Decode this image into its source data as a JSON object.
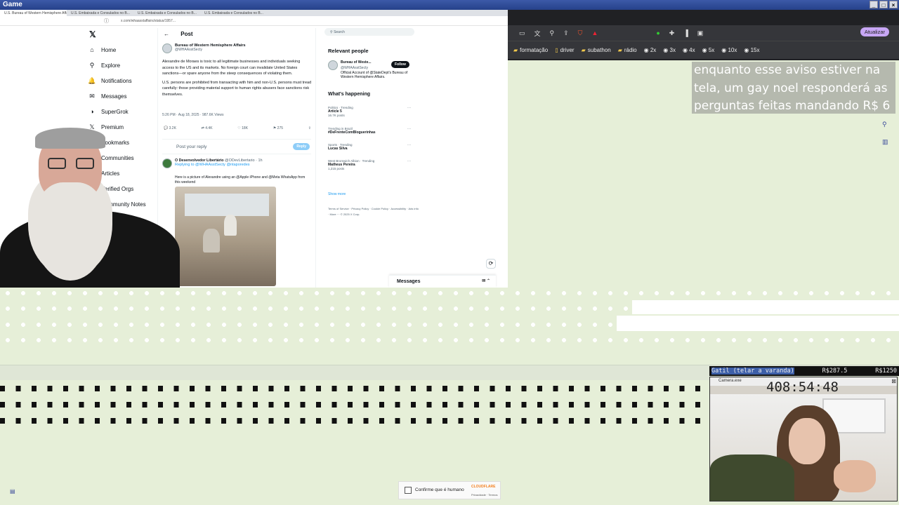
{
  "window": {
    "title": "Game"
  },
  "browser": {
    "tabs": [
      "U.S. Bureau of Western Hemisphere Affairs",
      "U.S. Embaixada e Consulados no B...",
      "U.S. Embaixada e Consulados no B...",
      "U.S. Embaixada e Consulados no B..."
    ],
    "url": "x.com/whaasstaffairs/status/1957..."
  },
  "x_nav": {
    "items": [
      {
        "icon": "home-icon",
        "glyph": "⌂",
        "label": "Home"
      },
      {
        "icon": "search-icon",
        "glyph": "⚲",
        "label": "Explore"
      },
      {
        "icon": "bell-icon",
        "glyph": "🔔",
        "label": "Notifications"
      },
      {
        "icon": "mail-icon",
        "glyph": "✉",
        "label": "Messages"
      },
      {
        "icon": "grok-icon",
        "glyph": "◑",
        "label": "SuperGrok"
      },
      {
        "icon": "x-icon",
        "glyph": "𝕏",
        "label": "Premium"
      },
      {
        "icon": "bookmark-icon",
        "glyph": "🔖",
        "label": "Bookmarks"
      },
      {
        "icon": "communities-icon",
        "glyph": "👥",
        "label": "Communities"
      },
      {
        "icon": "articles-icon",
        "glyph": "▤",
        "label": "Articles"
      },
      {
        "icon": "orgs-icon",
        "glyph": "⚡",
        "label": "Verified Orgs"
      },
      {
        "icon": "notes-icon",
        "glyph": "✎",
        "label": "Community Notes"
      }
    ]
  },
  "post": {
    "header": "Post",
    "author_name": "Bureau of Western Hemisphere Affairs",
    "author_handle": "@WHAAsstSecty",
    "p1": "Alexandre de Moraes is toxic to all legitimate businesses and individuals seeking access to the US and its markets. No foreign court can invalidate United States sanctions—or spare anyone from the steep consequences of violating them.",
    "p2": "U.S. persons are prohibited from transacting with him and non-U.S. persons must tread carefully: those providing material support to human rights abusers face sanctions risk themselves.",
    "meta": "5:26 PM · Aug 18, 2025 · 987.6K Views",
    "replies": "3.2K",
    "reposts": "4.4K",
    "likes": "18K",
    "bookmarks": "275",
    "reply_placeholder": "Post your reply",
    "reply_button": "Reply"
  },
  "reply": {
    "author": "O Desenvolvedor Libertário",
    "handle": "@ODevLibertario · 1h",
    "replying_to": "Replying to @WHAAsstSecty @ntaporedes",
    "text": "Here is a picture of Alexandre using an @Apple iPhone and @Meta WhatsApp from this weekend"
  },
  "right_sidebar": {
    "search_placeholder": "Search",
    "relevant_title": "Relevant people",
    "person_name": "Bureau of Weste...",
    "person_handle": "@WHAAsstSecty",
    "person_bio": "Official Account of @StateDept's Bureau of Western Hemisphere Affairs.",
    "follow_label": "Follow",
    "happening_title": "What's happening",
    "trends": [
      {
        "category": "Politics · Trending",
        "title": "Artícle 5",
        "count": "16.7K posts"
      },
      {
        "category": "Trending in Brazil",
        "title": "#DeFrenteComBloguerinhas",
        "count": ""
      },
      {
        "category": "Sports · Trending",
        "title": "Lucas Silva",
        "count": ""
      },
      {
        "category": "West Bromwich Albion · Trending",
        "title": "Matheus Pereira",
        "count": "1,215 posts"
      }
    ],
    "show_more": "Show more",
    "footer": "Terms of Service · Privacy Policy · Cookie Policy · Accessibility · Ads info · More ··· © 2025 X Corp.",
    "messages_label": "Messages"
  },
  "right_browser": {
    "update_label": "Atualizar",
    "bookmarks": [
      "formatação",
      "driver",
      "subathon",
      "rádio",
      "2x",
      "3x",
      "4x",
      "5x",
      "10x",
      "15x"
    ]
  },
  "overlay": {
    "text": "enquanto esse aviso estiver na tela, um gay noel responderá as perguntas feitas mandando R$ 6"
  },
  "stream_status": {
    "label": "Gatil (telar a varanda)",
    "goal_current": "R$287.5",
    "goal_total": "R$1250",
    "window_title": "Camera.exe",
    "timer": "408:54:48"
  },
  "captcha": {
    "label": "Confirme que é humano",
    "brand": "CLOUDFLARE",
    "links": "Privacidade · Termos"
  }
}
